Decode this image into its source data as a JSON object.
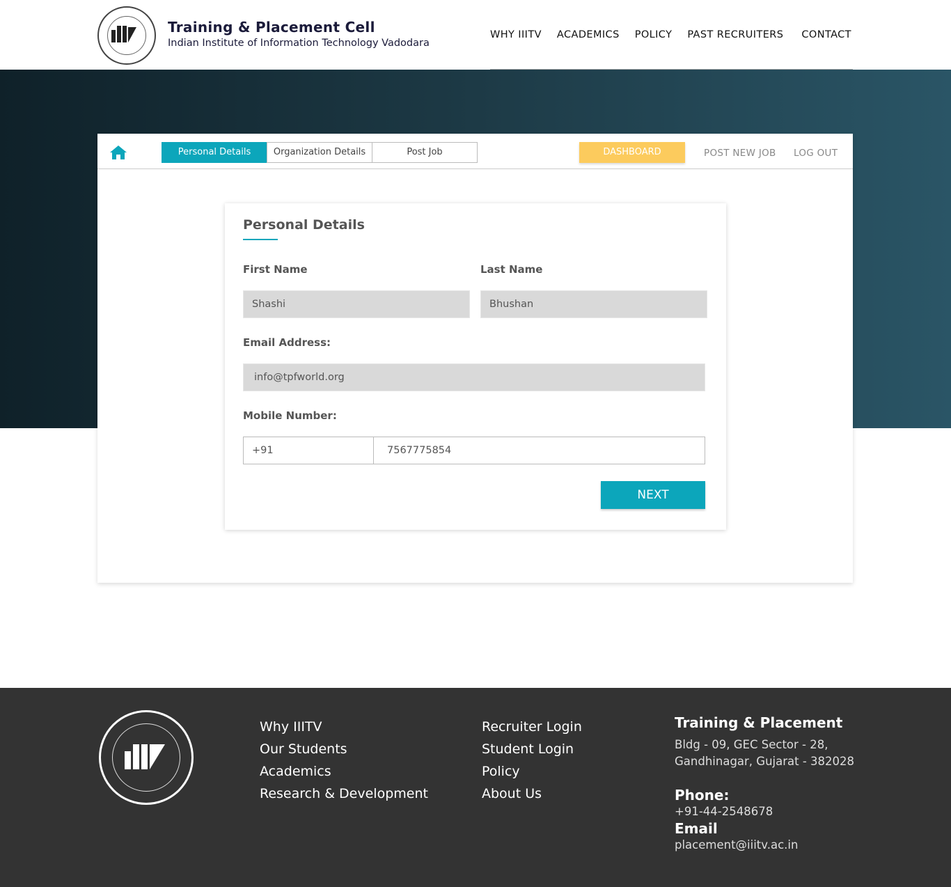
{
  "header": {
    "title": "Training & Placement Cell",
    "subtitle": "Indian Institute of Information Technology Vadodara",
    "nav": [
      "WHY IIITV",
      "ACADEMICS",
      "POLICY",
      "PAST RECRUITERS",
      "CONTACT"
    ]
  },
  "panel": {
    "tabs": [
      "Personal Details",
      "Organization Details",
      "Post Job"
    ],
    "active_tab": "Personal Details",
    "dashboard_label": "DASHBOARD",
    "post_job_label": "POST NEW JOB",
    "logout_label": "LOG OUT"
  },
  "form": {
    "title": "Personal Details",
    "first_name_label": "First Name",
    "first_name_value": "Shashi",
    "last_name_label": "Last Name",
    "last_name_value": "Bhushan",
    "email_label": "Email Address:",
    "email_value": "info@tpfworld.org",
    "mobile_label": "Mobile Number:",
    "country_code": "+91",
    "mobile_value": "7567775854",
    "next_label": "NEXT"
  },
  "footer": {
    "col1": [
      "Why IIITV",
      "Our Students",
      "Academics",
      "Research & Development"
    ],
    "col2": [
      "Recruiter Login",
      "Student Login",
      "Policy",
      "About Us"
    ],
    "contact_title": "Training & Placement",
    "address_line1": "Bldg - 09, GEC Sector - 28,",
    "address_line2": "Gandhinagar, Gujarat - 382028",
    "phone_label": "Phone:",
    "phone_value": "+91-44-2548678",
    "email_label": "Email",
    "email_value": "placement@iiitv.ac.in"
  },
  "colors": {
    "accent": "#0ca6bb",
    "dashboard": "#fccb5d",
    "footer_bg": "#333333"
  }
}
